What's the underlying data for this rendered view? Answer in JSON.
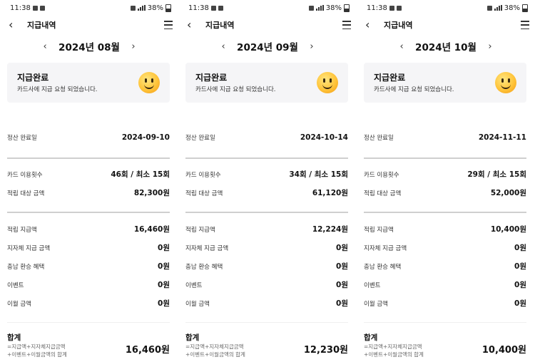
{
  "phones": [
    {
      "status": {
        "time": "11:38",
        "battery": "38%"
      },
      "header": {
        "title": "지급내역"
      },
      "month": {
        "label": "2024년 08월"
      },
      "card": {
        "title": "지급완료",
        "desc": "카드사에 지급 요청 되었습니다."
      },
      "settle": {
        "key": "정산 완료일",
        "value": "2024-09-10"
      },
      "usage": {
        "key": "카드 이용횟수",
        "value": "46회 / 최소 15회"
      },
      "target": {
        "key": "적립 대상 금액",
        "value": "82,300원"
      },
      "earned": {
        "key": "적립 지급액",
        "value": "16,460원"
      },
      "local": {
        "key": "지자체 지급 금액",
        "value": "0원"
      },
      "chungnam": {
        "key": "충남 환승 혜택",
        "value": "0원"
      },
      "event": {
        "key": "이벤트",
        "value": "0원"
      },
      "carry": {
        "key": "이월 금액",
        "value": "0원"
      },
      "total": {
        "key": "합계",
        "note1": "=지급액+지자체지급금액",
        "note2": "+이벤트+이월금액의 합계",
        "value": "16,460원"
      }
    },
    {
      "status": {
        "time": "11:38",
        "battery": "38%"
      },
      "header": {
        "title": "지급내역"
      },
      "month": {
        "label": "2024년 09월"
      },
      "card": {
        "title": "지급완료",
        "desc": "카드사에 지급 요청 되었습니다."
      },
      "settle": {
        "key": "정산 완료일",
        "value": "2024-10-14"
      },
      "usage": {
        "key": "카드 이용횟수",
        "value": "34회 / 최소 15회"
      },
      "target": {
        "key": "적립 대상 금액",
        "value": "61,120원"
      },
      "earned": {
        "key": "적립 지급액",
        "value": "12,224원"
      },
      "local": {
        "key": "지자체 지급 금액",
        "value": "0원"
      },
      "chungnam": {
        "key": "충남 환승 혜택",
        "value": "0원"
      },
      "event": {
        "key": "이벤트",
        "value": "0원"
      },
      "carry": {
        "key": "이월 금액",
        "value": "0원"
      },
      "total": {
        "key": "합계",
        "note1": "=지급액+지자체지급금액",
        "note2": "+이벤트+이월금액의 합계",
        "value": "12,230원"
      }
    },
    {
      "status": {
        "time": "11:38",
        "battery": "38%"
      },
      "header": {
        "title": "지급내역"
      },
      "month": {
        "label": "2024년 10월"
      },
      "card": {
        "title": "지급완료",
        "desc": "카드사에 지급 요청 되었습니다."
      },
      "settle": {
        "key": "정산 완료일",
        "value": "2024-11-11"
      },
      "usage": {
        "key": "카드 이용횟수",
        "value": "29회 / 최소 15회"
      },
      "target": {
        "key": "적립 대상 금액",
        "value": "52,000원"
      },
      "earned": {
        "key": "적립 지급액",
        "value": "10,400원"
      },
      "local": {
        "key": "지자체 지급 금액",
        "value": "0원"
      },
      "chungnam": {
        "key": "충남 환승 혜택",
        "value": "0원"
      },
      "event": {
        "key": "이벤트",
        "value": "0원"
      },
      "carry": {
        "key": "이월 금액",
        "value": "0원"
      },
      "total": {
        "key": "합계",
        "note1": "=지급액+지자체지급금액",
        "note2": "+이벤트+이월금액의 합계",
        "value": "10,400원"
      }
    }
  ]
}
